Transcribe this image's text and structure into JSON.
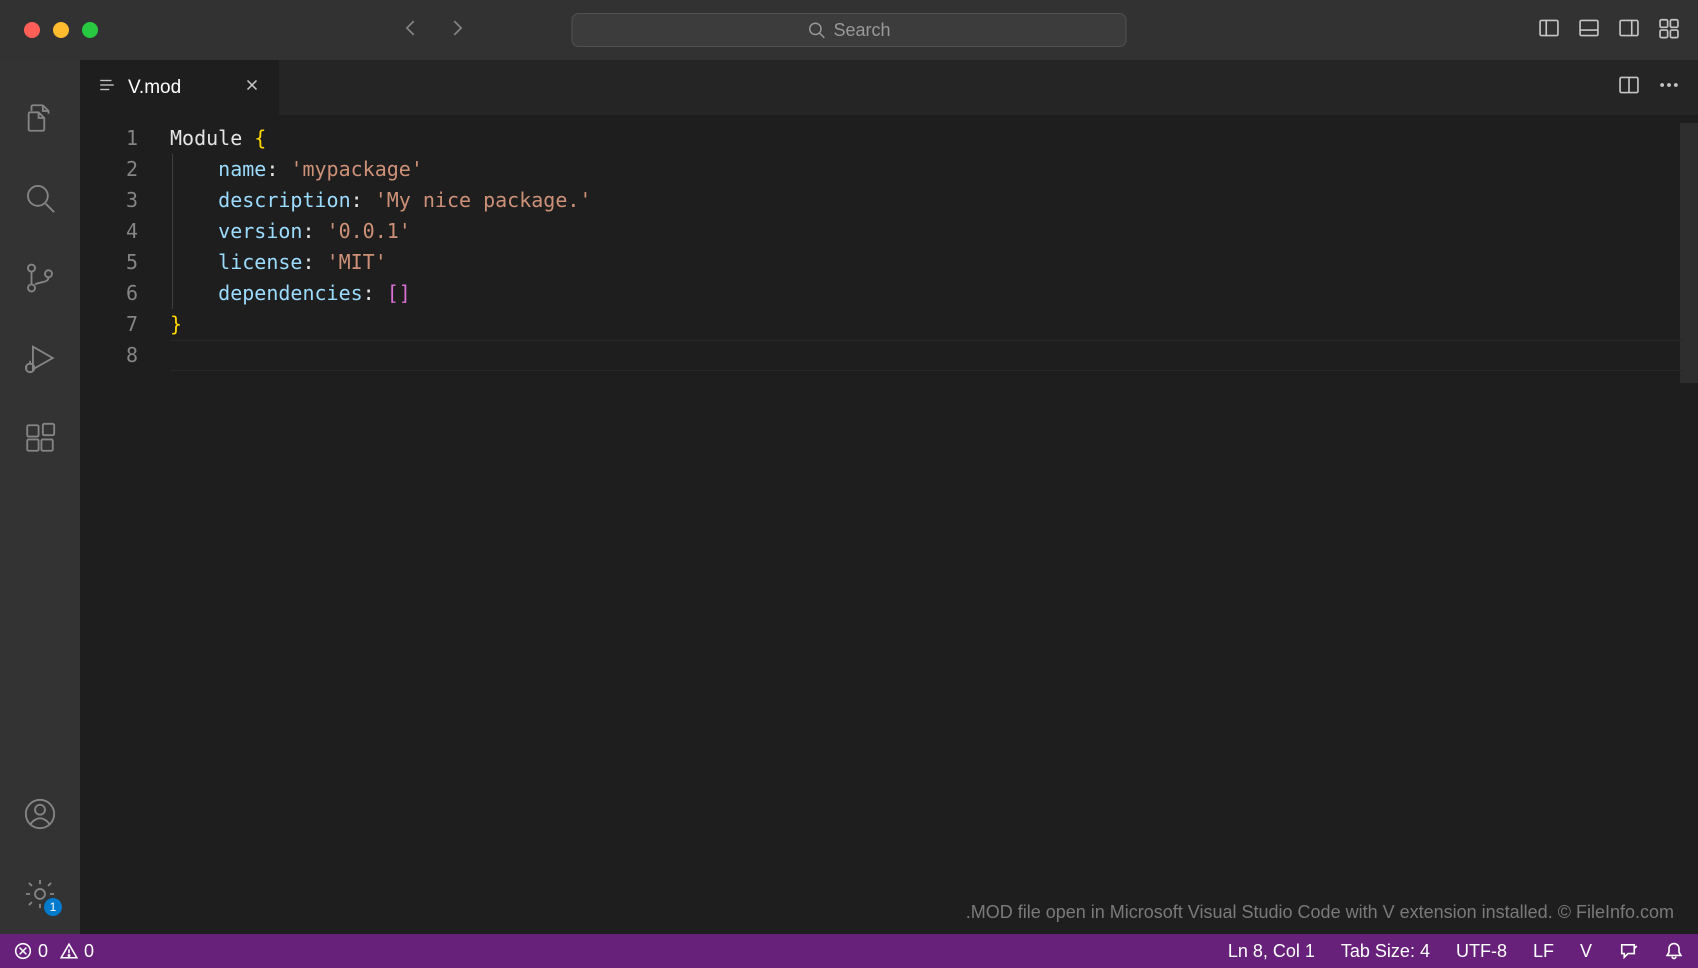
{
  "titlebar": {
    "search_placeholder": "Search"
  },
  "activitybar": {
    "settings_badge": "1"
  },
  "tab": {
    "filename": "V.mod"
  },
  "editor": {
    "line_numbers": [
      "1",
      "2",
      "3",
      "4",
      "5",
      "6",
      "7",
      "8"
    ],
    "lines": [
      {
        "segments": [
          {
            "t": "Module ",
            "c": "tk-keyword"
          },
          {
            "t": "{",
            "c": "tk-brace"
          }
        ]
      },
      {
        "segments": [
          {
            "t": "    ",
            "c": ""
          },
          {
            "t": "name",
            "c": "tk-key"
          },
          {
            "t": ": ",
            "c": "tk-punct"
          },
          {
            "t": "'mypackage'",
            "c": "tk-string"
          }
        ]
      },
      {
        "segments": [
          {
            "t": "    ",
            "c": ""
          },
          {
            "t": "description",
            "c": "tk-key"
          },
          {
            "t": ": ",
            "c": "tk-punct"
          },
          {
            "t": "'My nice package.'",
            "c": "tk-string"
          }
        ]
      },
      {
        "segments": [
          {
            "t": "    ",
            "c": ""
          },
          {
            "t": "version",
            "c": "tk-key"
          },
          {
            "t": ": ",
            "c": "tk-punct"
          },
          {
            "t": "'0.0.1'",
            "c": "tk-string"
          }
        ]
      },
      {
        "segments": [
          {
            "t": "    ",
            "c": ""
          },
          {
            "t": "license",
            "c": "tk-key"
          },
          {
            "t": ": ",
            "c": "tk-punct"
          },
          {
            "t": "'MIT'",
            "c": "tk-string"
          }
        ]
      },
      {
        "segments": [
          {
            "t": "    ",
            "c": ""
          },
          {
            "t": "dependencies",
            "c": "tk-key"
          },
          {
            "t": ": ",
            "c": "tk-punct"
          },
          {
            "t": "[]",
            "c": "tk-bracket"
          }
        ]
      },
      {
        "segments": [
          {
            "t": "}",
            "c": "tk-brace"
          }
        ]
      },
      {
        "segments": [
          {
            "t": "",
            "c": ""
          }
        ]
      }
    ],
    "active_line_index": 7
  },
  "watermark": ".MOD file open in Microsoft Visual Studio Code with V extension installed. © FileInfo.com",
  "statusbar": {
    "errors": "0",
    "warnings": "0",
    "cursor": "Ln 8, Col 1",
    "tabsize": "Tab Size: 4",
    "encoding": "UTF-8",
    "eol": "LF",
    "language": "V"
  }
}
